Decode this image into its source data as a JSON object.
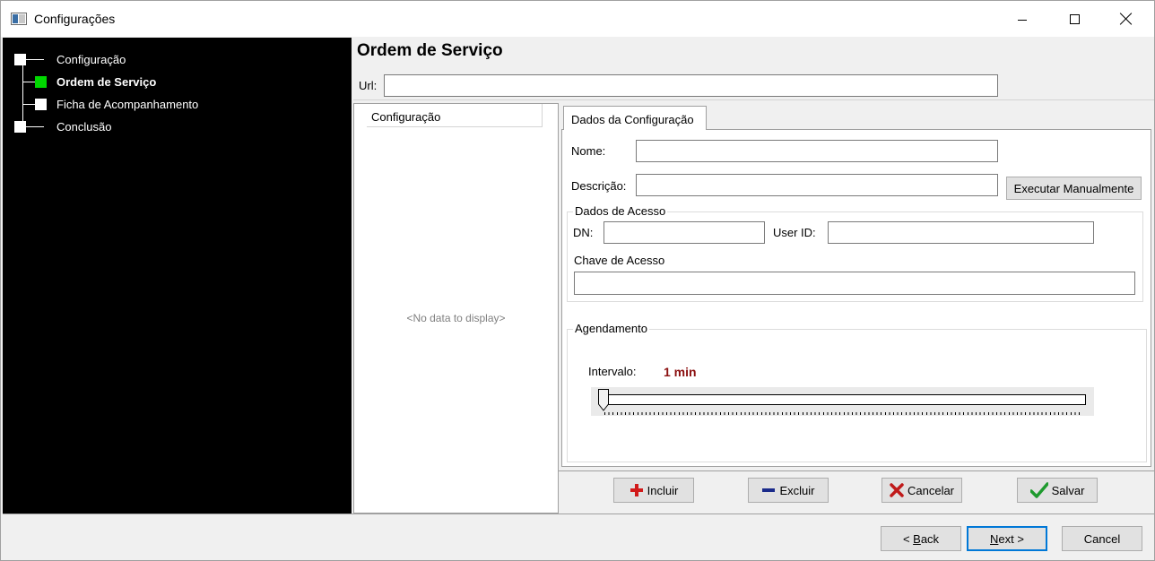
{
  "window": {
    "title": "Configurações"
  },
  "tree": {
    "items": [
      {
        "label": "Configuração",
        "state": "done"
      },
      {
        "label": "Ordem de Serviço",
        "state": "current"
      },
      {
        "label": "Ficha de Acompanhamento",
        "state": "pending"
      },
      {
        "label": "Conclusão",
        "state": "pending"
      }
    ],
    "current_color": "#00d800"
  },
  "page": {
    "title": "Ordem de Serviço",
    "url_label": "Url:",
    "url_value": ""
  },
  "grid": {
    "column_header": "Configuração",
    "empty_text": "<No data to display>"
  },
  "tab": {
    "label": "Dados da Configuração"
  },
  "form": {
    "nome_label": "Nome:",
    "nome_value": "",
    "descricao_label": "Descrição:",
    "descricao_value": "",
    "executar_button": "Executar Manualmente"
  },
  "access": {
    "legend": "Dados de Acesso",
    "dn_label": "DN:",
    "dn_value": "",
    "userid_label": "User ID:",
    "userid_value": "",
    "chave_label": "Chave de Acesso",
    "chave_value": ""
  },
  "schedule": {
    "legend": "Agendamento",
    "interval_label": "Intervalo:",
    "interval_value": "1 min",
    "slider_level": 0
  },
  "actions": {
    "incluir": "Incluir",
    "excluir": "Excluir",
    "cancelar": "Cancelar",
    "salvar": "Salvar"
  },
  "footer": {
    "back_prefix": "< ",
    "back_mnemonic": "B",
    "back_rest": "ack",
    "next_mnemonic": "N",
    "next_rest": "ext >",
    "cancel": "Cancel"
  }
}
